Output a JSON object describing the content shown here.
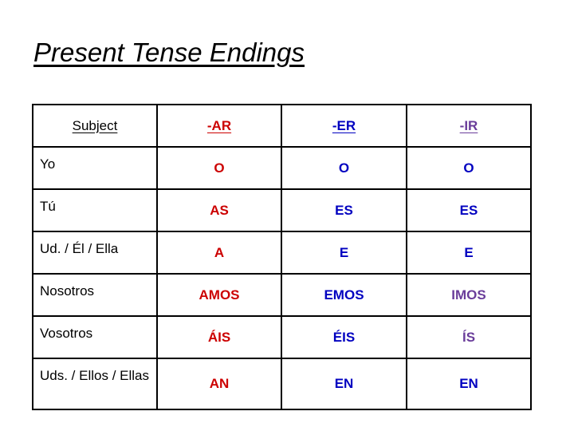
{
  "slide": {
    "title": "Present Tense Endings"
  },
  "colors": {
    "ar": "#CC0000",
    "er": "#0000C0",
    "ir": "#6A3D9A",
    "subject": "#000000",
    "border": "#000000",
    "background": "#FFFFFF"
  },
  "table": {
    "headers": [
      {
        "label": "Subject",
        "color_key": "subject"
      },
      {
        "label": "-AR",
        "color_key": "ar"
      },
      {
        "label": "-ER",
        "color_key": "er"
      },
      {
        "label": "-IR",
        "color_key": "ir"
      }
    ],
    "rows": [
      {
        "subject": "Yo",
        "ar": "O",
        "er": "O",
        "ir": "O",
        "ir_color_key": "er"
      },
      {
        "subject": "Tú",
        "ar": "AS",
        "er": "ES",
        "ir": "ES",
        "ir_color_key": "er"
      },
      {
        "subject": "Ud. / Él / Ella",
        "ar": "A",
        "er": "E",
        "ir": "E",
        "ir_color_key": "er"
      },
      {
        "subject": "Nosotros",
        "ar": "AMOS",
        "er": "EMOS",
        "ir": "IMOS",
        "ir_color_key": "ir"
      },
      {
        "subject": "Vosotros",
        "ar": "ÁIS",
        "er": "ÉIS",
        "ir": "ÍS",
        "ir_color_key": "ir"
      },
      {
        "subject": "Uds. / Ellos / Ellas",
        "ar": "AN",
        "er": "EN",
        "ir": "EN",
        "ir_color_key": "er"
      }
    ]
  }
}
